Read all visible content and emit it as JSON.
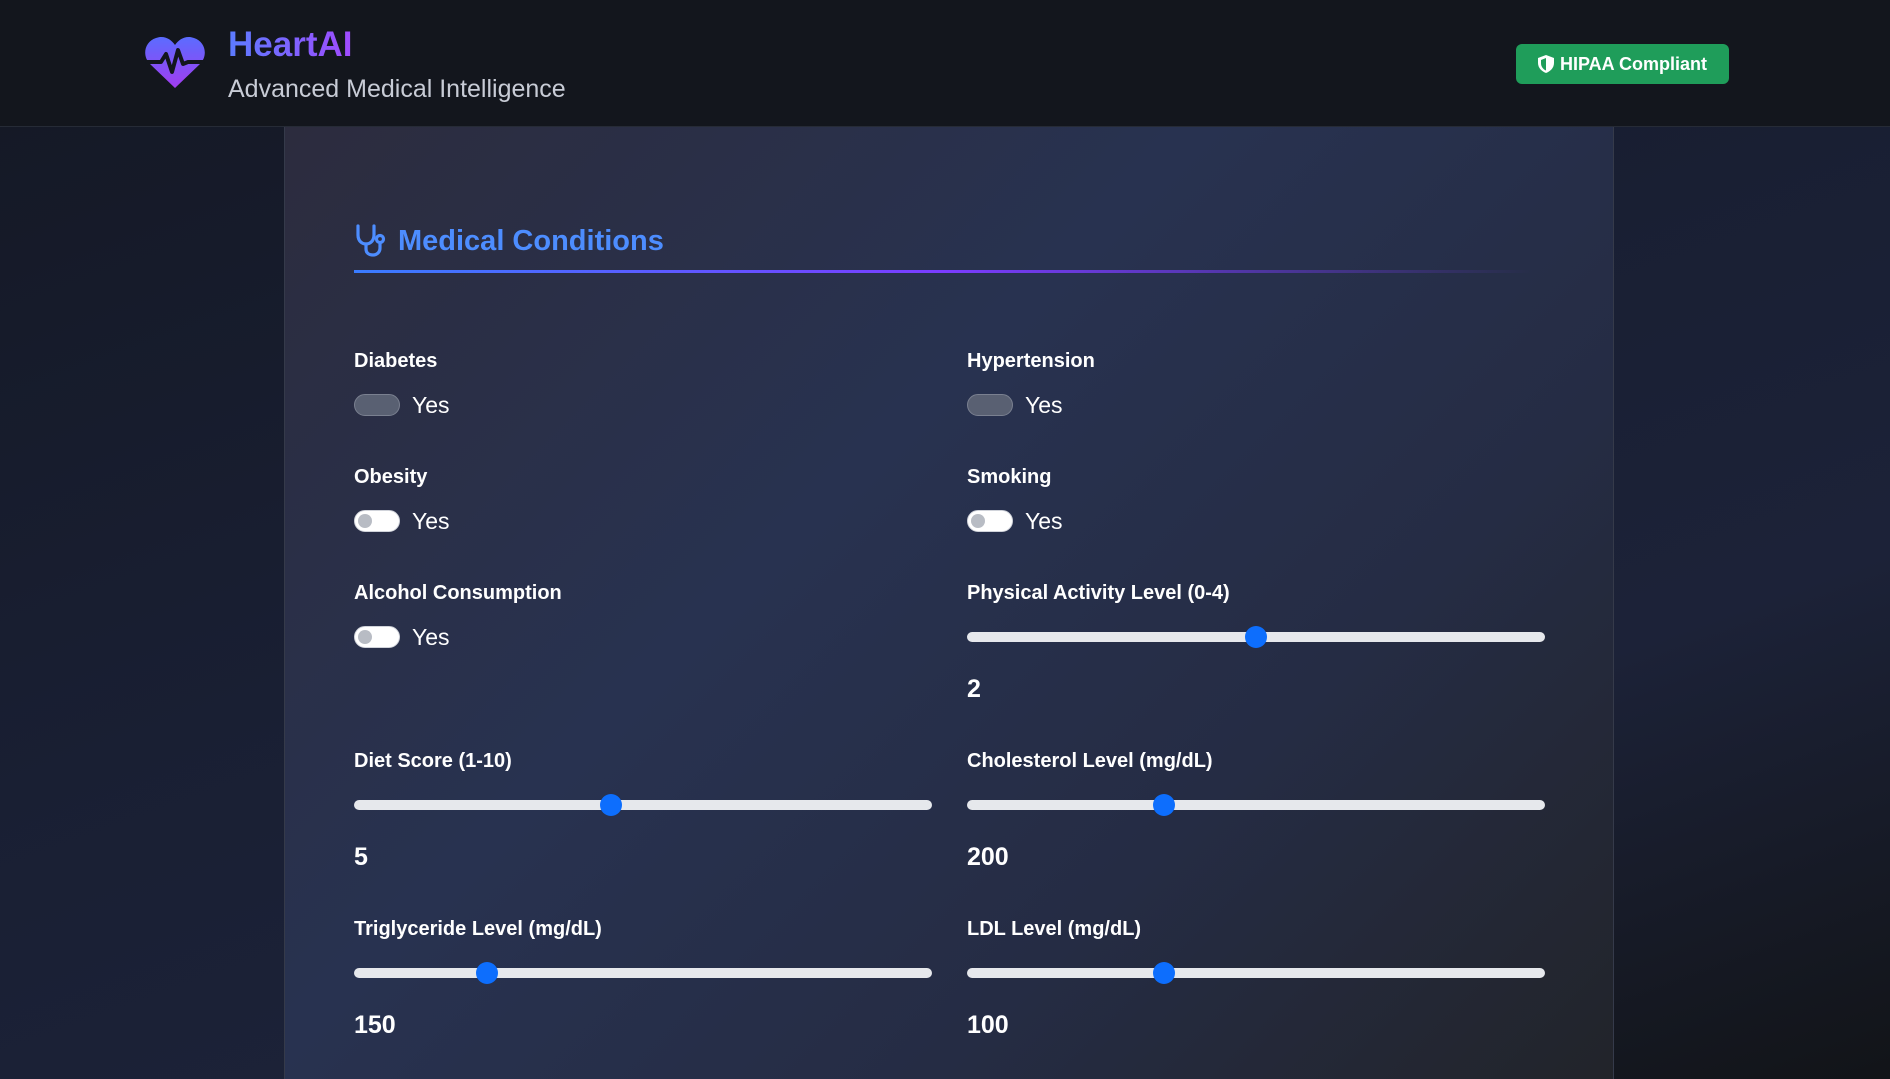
{
  "header": {
    "brand_title": "HeartAI",
    "brand_subtitle": "Advanced Medical Intelligence",
    "badge_label": "HIPAA Compliant",
    "badge_icon": "shield-icon",
    "logo_icon": "heart-pulse-icon",
    "badge_color": "#1f9d5a"
  },
  "section": {
    "title": "Medical Conditions",
    "icon": "stethoscope-icon",
    "accent_color": "#4d8dff"
  },
  "toggles": [
    {
      "label": "Diabetes",
      "option": "Yes"
    },
    {
      "label": "Hypertension",
      "option": "Yes"
    },
    {
      "label": "Obesity",
      "option": "Yes"
    },
    {
      "label": "Smoking",
      "option": "Yes"
    },
    {
      "label": "Alcohol Consumption",
      "option": "Yes"
    }
  ],
  "sliders": [
    {
      "label": "Physical Activity Level (0-4)",
      "value": "2",
      "min": 0,
      "max": 4
    },
    {
      "label": "Diet Score (1-10)",
      "value": "5",
      "min": 1,
      "max": 10
    },
    {
      "label": "Cholesterol Level (mg/dL)",
      "value": "200",
      "fraction": 0.34
    },
    {
      "label": "Triglyceride Level (mg/dL)",
      "value": "150",
      "fraction": 0.23
    },
    {
      "label": "LDL Level (mg/dL)",
      "value": "100",
      "fraction": 0.34
    }
  ]
}
